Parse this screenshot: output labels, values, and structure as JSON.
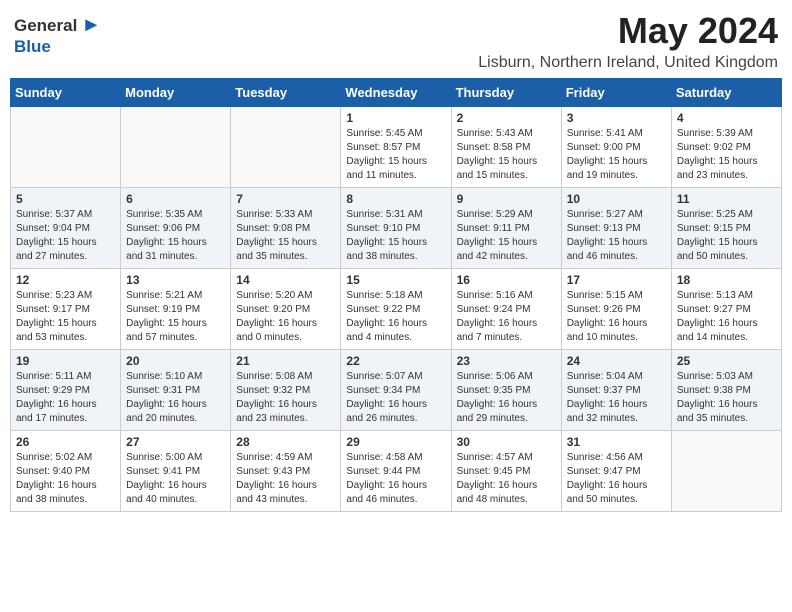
{
  "header": {
    "logo_general": "General",
    "logo_blue": "Blue",
    "month_year": "May 2024",
    "location": "Lisburn, Northern Ireland, United Kingdom"
  },
  "days_of_week": [
    "Sunday",
    "Monday",
    "Tuesday",
    "Wednesday",
    "Thursday",
    "Friday",
    "Saturday"
  ],
  "weeks": [
    {
      "row_bg": "white",
      "days": [
        {
          "number": "",
          "info": ""
        },
        {
          "number": "",
          "info": ""
        },
        {
          "number": "",
          "info": ""
        },
        {
          "number": "1",
          "info": "Sunrise: 5:45 AM\nSunset: 8:57 PM\nDaylight: 15 hours\nand 11 minutes."
        },
        {
          "number": "2",
          "info": "Sunrise: 5:43 AM\nSunset: 8:58 PM\nDaylight: 15 hours\nand 15 minutes."
        },
        {
          "number": "3",
          "info": "Sunrise: 5:41 AM\nSunset: 9:00 PM\nDaylight: 15 hours\nand 19 minutes."
        },
        {
          "number": "4",
          "info": "Sunrise: 5:39 AM\nSunset: 9:02 PM\nDaylight: 15 hours\nand 23 minutes."
        }
      ]
    },
    {
      "row_bg": "gray",
      "days": [
        {
          "number": "5",
          "info": "Sunrise: 5:37 AM\nSunset: 9:04 PM\nDaylight: 15 hours\nand 27 minutes."
        },
        {
          "number": "6",
          "info": "Sunrise: 5:35 AM\nSunset: 9:06 PM\nDaylight: 15 hours\nand 31 minutes."
        },
        {
          "number": "7",
          "info": "Sunrise: 5:33 AM\nSunset: 9:08 PM\nDaylight: 15 hours\nand 35 minutes."
        },
        {
          "number": "8",
          "info": "Sunrise: 5:31 AM\nSunset: 9:10 PM\nDaylight: 15 hours\nand 38 minutes."
        },
        {
          "number": "9",
          "info": "Sunrise: 5:29 AM\nSunset: 9:11 PM\nDaylight: 15 hours\nand 42 minutes."
        },
        {
          "number": "10",
          "info": "Sunrise: 5:27 AM\nSunset: 9:13 PM\nDaylight: 15 hours\nand 46 minutes."
        },
        {
          "number": "11",
          "info": "Sunrise: 5:25 AM\nSunset: 9:15 PM\nDaylight: 15 hours\nand 50 minutes."
        }
      ]
    },
    {
      "row_bg": "white",
      "days": [
        {
          "number": "12",
          "info": "Sunrise: 5:23 AM\nSunset: 9:17 PM\nDaylight: 15 hours\nand 53 minutes."
        },
        {
          "number": "13",
          "info": "Sunrise: 5:21 AM\nSunset: 9:19 PM\nDaylight: 15 hours\nand 57 minutes."
        },
        {
          "number": "14",
          "info": "Sunrise: 5:20 AM\nSunset: 9:20 PM\nDaylight: 16 hours\nand 0 minutes."
        },
        {
          "number": "15",
          "info": "Sunrise: 5:18 AM\nSunset: 9:22 PM\nDaylight: 16 hours\nand 4 minutes."
        },
        {
          "number": "16",
          "info": "Sunrise: 5:16 AM\nSunset: 9:24 PM\nDaylight: 16 hours\nand 7 minutes."
        },
        {
          "number": "17",
          "info": "Sunrise: 5:15 AM\nSunset: 9:26 PM\nDaylight: 16 hours\nand 10 minutes."
        },
        {
          "number": "18",
          "info": "Sunrise: 5:13 AM\nSunset: 9:27 PM\nDaylight: 16 hours\nand 14 minutes."
        }
      ]
    },
    {
      "row_bg": "gray",
      "days": [
        {
          "number": "19",
          "info": "Sunrise: 5:11 AM\nSunset: 9:29 PM\nDaylight: 16 hours\nand 17 minutes."
        },
        {
          "number": "20",
          "info": "Sunrise: 5:10 AM\nSunset: 9:31 PM\nDaylight: 16 hours\nand 20 minutes."
        },
        {
          "number": "21",
          "info": "Sunrise: 5:08 AM\nSunset: 9:32 PM\nDaylight: 16 hours\nand 23 minutes."
        },
        {
          "number": "22",
          "info": "Sunrise: 5:07 AM\nSunset: 9:34 PM\nDaylight: 16 hours\nand 26 minutes."
        },
        {
          "number": "23",
          "info": "Sunrise: 5:06 AM\nSunset: 9:35 PM\nDaylight: 16 hours\nand 29 minutes."
        },
        {
          "number": "24",
          "info": "Sunrise: 5:04 AM\nSunset: 9:37 PM\nDaylight: 16 hours\nand 32 minutes."
        },
        {
          "number": "25",
          "info": "Sunrise: 5:03 AM\nSunset: 9:38 PM\nDaylight: 16 hours\nand 35 minutes."
        }
      ]
    },
    {
      "row_bg": "white",
      "days": [
        {
          "number": "26",
          "info": "Sunrise: 5:02 AM\nSunset: 9:40 PM\nDaylight: 16 hours\nand 38 minutes."
        },
        {
          "number": "27",
          "info": "Sunrise: 5:00 AM\nSunset: 9:41 PM\nDaylight: 16 hours\nand 40 minutes."
        },
        {
          "number": "28",
          "info": "Sunrise: 4:59 AM\nSunset: 9:43 PM\nDaylight: 16 hours\nand 43 minutes."
        },
        {
          "number": "29",
          "info": "Sunrise: 4:58 AM\nSunset: 9:44 PM\nDaylight: 16 hours\nand 46 minutes."
        },
        {
          "number": "30",
          "info": "Sunrise: 4:57 AM\nSunset: 9:45 PM\nDaylight: 16 hours\nand 48 minutes."
        },
        {
          "number": "31",
          "info": "Sunrise: 4:56 AM\nSunset: 9:47 PM\nDaylight: 16 hours\nand 50 minutes."
        },
        {
          "number": "",
          "info": ""
        }
      ]
    }
  ]
}
